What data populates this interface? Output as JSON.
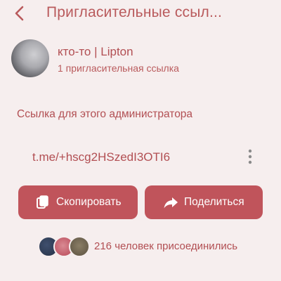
{
  "header": {
    "title": "Пригласительные ссыл...",
    "back_icon": "arrow-left-icon"
  },
  "profile": {
    "name": "кто-то | Lipton",
    "subtitle": "1 пригласительная ссылка"
  },
  "link_section": {
    "label": "Ссылка для этого администратора",
    "link": "t.me/+hscg2HSzedI3OTI6",
    "more_icon": "more-vertical-icon"
  },
  "actions": {
    "copy_label": "Скопировать",
    "copy_icon": "copy-icon",
    "share_label": "Поделиться",
    "share_icon": "share-arrow-icon"
  },
  "joined": {
    "text": "216 человек присоединились"
  },
  "colors": {
    "background": "#f6eeee",
    "accent": "#b24f53",
    "button": "#c0545b",
    "button_text": "#ffffff"
  }
}
